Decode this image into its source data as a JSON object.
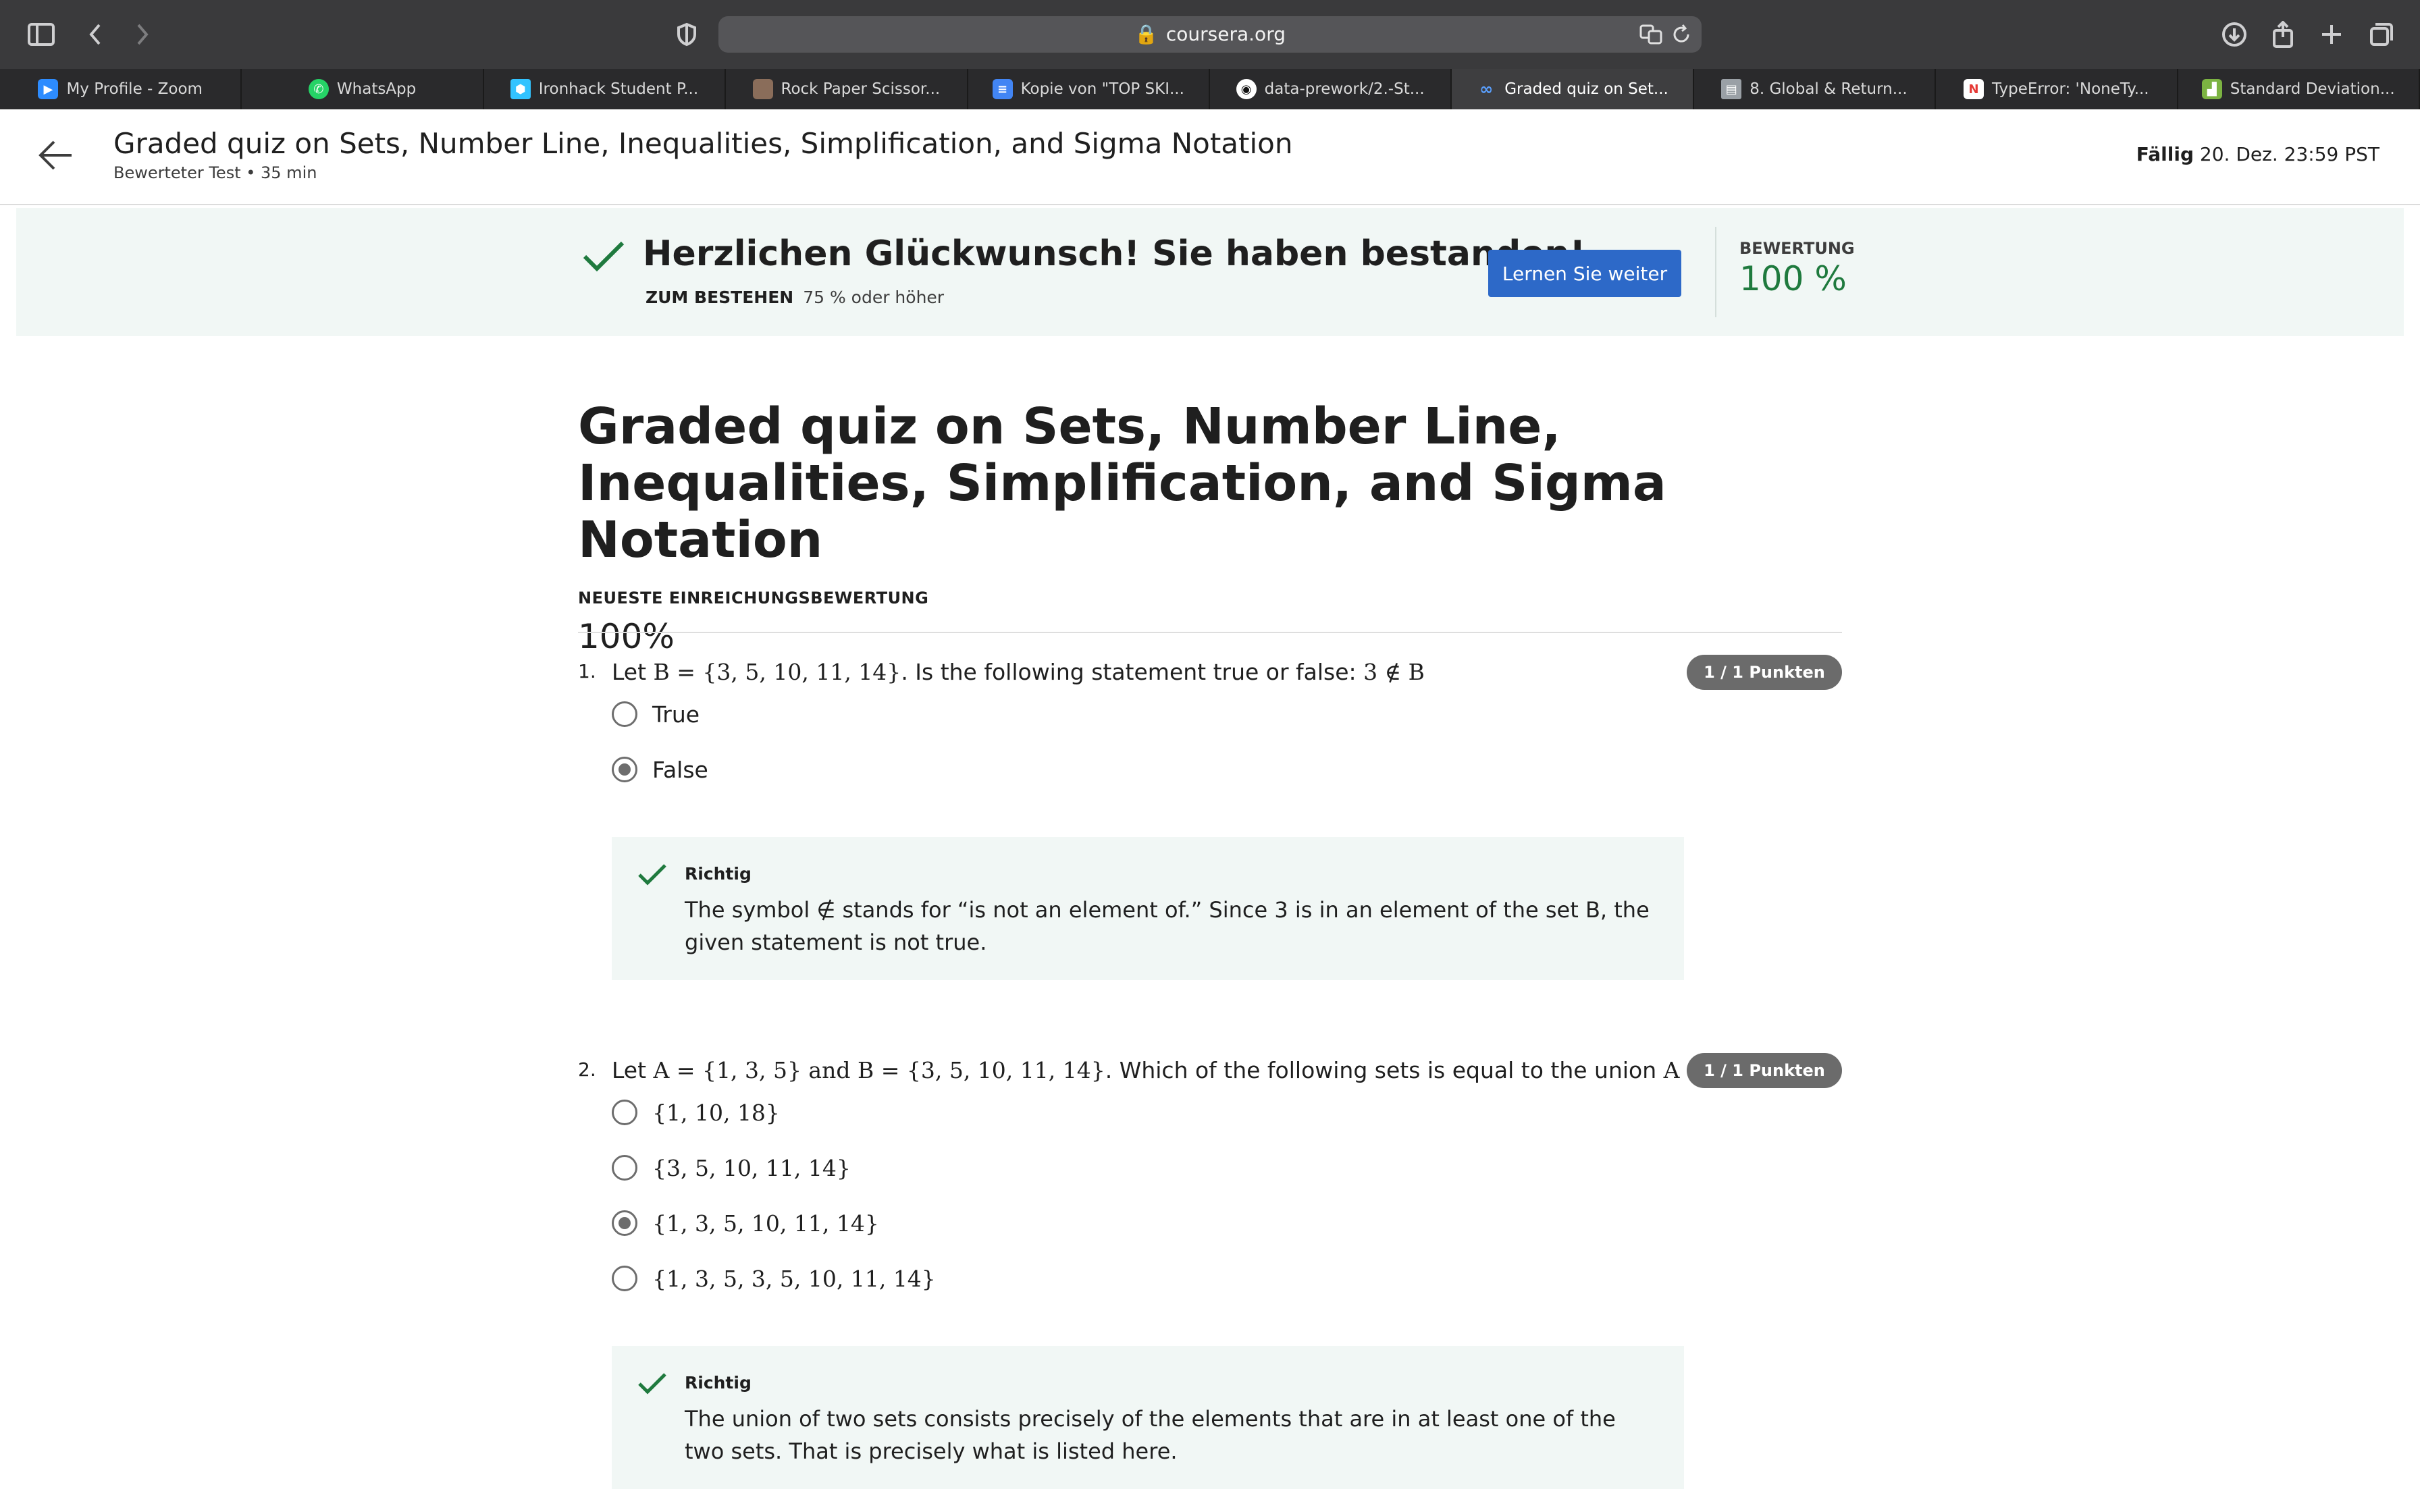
{
  "browser": {
    "url": "coursera.org",
    "tabs": [
      {
        "label": "My Profile - Zoom",
        "icon": "zoom-icon",
        "color": "#2d8cff"
      },
      {
        "label": "WhatsApp",
        "icon": "whatsapp-icon",
        "color": "#25d366"
      },
      {
        "label": "Ironhack Student P...",
        "icon": "ironhack-icon",
        "color": "#32c3ff"
      },
      {
        "label": "Rock Paper Scissor...",
        "icon": "image-icon",
        "color": "#8a6d5a"
      },
      {
        "label": "Kopie von \"TOP SKI...",
        "icon": "docs-icon",
        "color": "#4285f4"
      },
      {
        "label": "data-prework/2.-St...",
        "icon": "github-icon",
        "color": "#ffffff"
      },
      {
        "label": "Graded quiz on Set...",
        "icon": "coursera-icon",
        "color": "#2a73cc",
        "active": true
      },
      {
        "label": "8. Global & Return...",
        "icon": "book-icon",
        "color": "#9aa0a6"
      },
      {
        "label": "TypeError: 'NoneTy...",
        "icon": "n-icon",
        "color": "#e53935"
      },
      {
        "label": "Standard Deviation...",
        "icon": "chart-icon",
        "color": "#7cb342"
      }
    ]
  },
  "header": {
    "title": "Graded quiz on Sets, Number Line, Inequalities, Simplification, and Sigma Notation",
    "subtitle": "Bewerteter Test • 35 min",
    "due_label": "Fällig",
    "due_value": "20. Dez. 23:59 PST"
  },
  "banner": {
    "title": "Herzlichen Glückwunsch! Sie haben bestanden!",
    "pass_label": "ZUM BESTEHEN",
    "pass_value": "75 % oder höher",
    "button": "Lernen Sie weiter",
    "grade_label": "BEWERTUNG",
    "grade_value": "100 %",
    "accent_color": "#1f7a3e",
    "button_color": "#2d69c8"
  },
  "main": {
    "title": "Graded quiz on Sets, Number Line, Inequalities, Simplification, and Sigma Notation",
    "latest_label": "NEUESTE EINREICHUNGSBEWERTUNG",
    "latest_value": "100%"
  },
  "questions": [
    {
      "number": "1.",
      "text_prefix": "Let",
      "math_1": "B = {3, 5, 10, 11, 14}",
      "text_mid": ". Is the following statement true or false:",
      "math_2": "3 ∉ B",
      "points": "1 / 1 Punkten",
      "options": [
        {
          "label": "True",
          "selected": false
        },
        {
          "label": "False",
          "selected": true
        }
      ],
      "feedback_label": "Richtig",
      "feedback_text": "The symbol ∉ stands for “is not an element of.” Since 3 is in an element of the set B, the given statement is not true."
    },
    {
      "number": "2.",
      "text_prefix": "Let",
      "math_1": "A = {1, 3, 5} and B = {3, 5, 10, 11, 14}",
      "text_mid": ". Which of the following sets is equal to the union",
      "math_2": "A ∪ B",
      "text_suffix": "?",
      "points": "1 / 1 Punkten",
      "options": [
        {
          "label": "{1, 10, 18}",
          "selected": false
        },
        {
          "label": "{3, 5, 10, 11, 14}",
          "selected": false
        },
        {
          "label": "{1, 3, 5, 10, 11, 14}",
          "selected": true
        },
        {
          "label": "{1, 3, 5, 3, 5, 10, 11, 14}",
          "selected": false
        }
      ],
      "feedback_label": "Richtig",
      "feedback_text": "The union of two sets consists precisely of the elements that are in at least one of the two sets. That is precisely what is listed here."
    }
  ]
}
